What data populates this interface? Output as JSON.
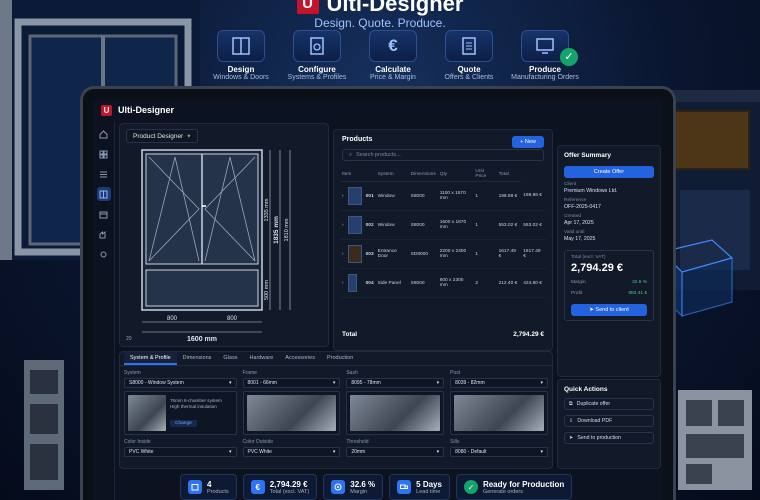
{
  "brand": {
    "logo": "U",
    "name": "Ulti-Designer",
    "tagline": "Design. Quote. Produce."
  },
  "steps": [
    {
      "icon": "window-icon",
      "title": "Design",
      "subtitle": "Windows & Doors"
    },
    {
      "icon": "gear-doc-icon",
      "title": "Configure",
      "subtitle": "Systems & Profiles"
    },
    {
      "icon": "euro-icon",
      "title": "Calculate",
      "subtitle": "Price & Margin"
    },
    {
      "icon": "document-icon",
      "title": "Quote",
      "subtitle": "Offers & Clients"
    },
    {
      "icon": "monitor-icon",
      "title": "Produce",
      "subtitle": "Manufacturing Orders"
    }
  ],
  "app": {
    "logo": "U",
    "title": "Ulti-Designer"
  },
  "designer": {
    "dropdown": "Product Designer",
    "dims": {
      "total_width": "1600 mm",
      "left_width": "800",
      "right_width": "800",
      "total_height": "1835 mm",
      "upper_height": "1335 mm",
      "lower_height": "500 mm",
      "sash_height": "1810 mm"
    },
    "zoom": "20"
  },
  "products": {
    "title": "Products",
    "new_label": "New",
    "search_placeholder": "Search products...",
    "columns": [
      "Item",
      "System",
      "Dimensions",
      "Qty",
      "Unit Price",
      "Total"
    ],
    "rows": [
      {
        "num": "001",
        "name": "Window",
        "system": "S8000",
        "dimensions": "1100 x 1570 mm",
        "qty": "1",
        "unit": "198.98 €",
        "total": "198.98 €"
      },
      {
        "num": "002",
        "name": "Window",
        "system": "S8000",
        "dimensions": "1600 x 1870 mm",
        "qty": "1",
        "unit": "553.02 €",
        "total": "553.02 €"
      },
      {
        "num": "003",
        "name": "Entrance Door",
        "system": "SD8000",
        "dimensions": "2200 x 2300 mm",
        "qty": "1",
        "unit": "1617.49 €",
        "total": "1617.49 €"
      },
      {
        "num": "004",
        "name": "Side Panel",
        "system": "S8000",
        "dimensions": "600 x 2300 mm",
        "qty": "2",
        "unit": "212.40 €",
        "total": "424.80 €"
      }
    ],
    "total_label": "Total",
    "total_value": "2,794.29 €"
  },
  "summary": {
    "title": "Offer Summary",
    "create_label": "Create Offer",
    "client_label": "Client",
    "client": "Premium Windows Ltd.",
    "reference_label": "Reference",
    "reference": "OFF-2025-0417",
    "created_label": "Created",
    "created": "Apr 17, 2025",
    "valid_label": "Valid until",
    "valid": "May 17, 2025",
    "total_label": "Total (excl. VAT)",
    "total": "2,794.29 €",
    "margin_label": "Margin",
    "margin": "32.6 %",
    "profit_label": "Profit",
    "profit": "883.41 €",
    "send_label": "Send to client"
  },
  "config": {
    "tabs": [
      "System & Profile",
      "Dimensions",
      "Glass",
      "Hardware",
      "Accessories",
      "Production"
    ],
    "system_label": "System",
    "system": "S8000 - Window System",
    "system_desc": "76mm 6-chamber system\nHigh thermal insulation",
    "change_label": "Change",
    "frame_label": "Frame",
    "frame": "8001 - 66mm",
    "sash_label": "Sash",
    "sash": "8095 - 78mm",
    "post_label": "Post",
    "post": "8039 - 82mm",
    "color_inside_label": "Color Inside",
    "color_inside": "PVC White",
    "color_outside_label": "Color Outside",
    "color_outside": "PVC White",
    "threshold_label": "Threshold",
    "threshold": "20mm",
    "sills_label": "Sills",
    "sills": "8080 - Default"
  },
  "quick": {
    "title": "Quick Actions",
    "items": [
      "Duplicate offer",
      "Download PDF",
      "Send to production"
    ]
  },
  "kpis": [
    {
      "icon": "calendar-icon",
      "value": "4",
      "label": "Products",
      "color": "#2e73f3"
    },
    {
      "icon": "euro-icon",
      "value": "2,794.29 €",
      "label": "Total (excl. VAT)",
      "color": "#2e73f3"
    },
    {
      "icon": "target-icon",
      "value": "32.6 %",
      "label": "Margin",
      "color": "#2e73f3"
    },
    {
      "icon": "truck-icon",
      "value": "5 Days",
      "label": "Lead time",
      "color": "#2e73f3"
    },
    {
      "icon": "check-circle-icon",
      "value": "Ready for Production",
      "label": "Generate orders",
      "color": "#14a36b"
    }
  ],
  "colors": {
    "accent": "#2463e0",
    "brand": "#c4142b",
    "success": "#14a36b"
  }
}
